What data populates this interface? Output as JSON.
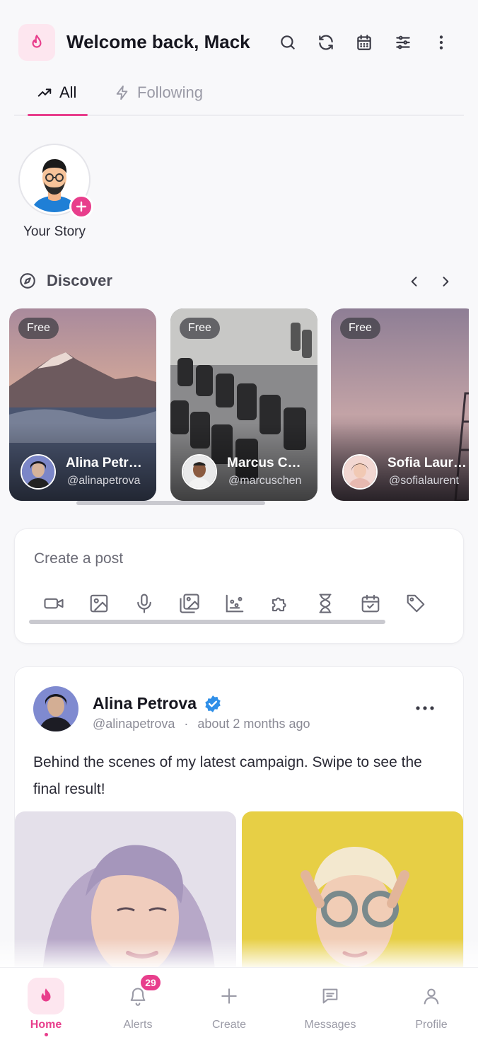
{
  "header": {
    "title": "Welcome back, Mack",
    "icons": [
      "search-icon",
      "refresh-icon",
      "calendar-icon",
      "sliders-icon",
      "more-vertical-icon"
    ]
  },
  "tabs": [
    {
      "label": "All",
      "icon": "trending-icon",
      "active": true
    },
    {
      "label": "Following",
      "icon": "bolt-icon",
      "active": false
    }
  ],
  "story": {
    "label": "Your Story"
  },
  "discover": {
    "title": "Discover",
    "cards": [
      {
        "badge": "Free",
        "name": "Alina Petr…",
        "handle": "@alinapetrova"
      },
      {
        "badge": "Free",
        "name": "Marcus C…",
        "handle": "@marcuschen"
      },
      {
        "badge": "Free",
        "name": "Sofia Laur…",
        "handle": "@sofialaurent"
      }
    ]
  },
  "create_post": {
    "placeholder": "Create a post",
    "tools": [
      "video-icon",
      "image-icon",
      "mic-icon",
      "gallery-icon",
      "chart-icon",
      "puzzle-icon",
      "hourglass-icon",
      "calendar-check-icon",
      "tag-icon"
    ]
  },
  "post": {
    "author": "Alina Petrova",
    "handle": "@alinapetrova",
    "separator": "·",
    "time": "about 2 months ago",
    "text": "Behind the scenes of my latest campaign. Swipe to see the final result!"
  },
  "bottom_nav": [
    {
      "label": "Home",
      "icon": "flame-icon",
      "active": true
    },
    {
      "label": "Alerts",
      "icon": "bell-icon",
      "badge": "29"
    },
    {
      "label": "Create",
      "icon": "plus-icon"
    },
    {
      "label": "Messages",
      "icon": "message-icon"
    },
    {
      "label": "Profile",
      "icon": "user-icon"
    }
  ],
  "colors": {
    "accent": "#e83e8c",
    "accent_soft": "#fde6ef",
    "verified": "#2f8fe8"
  }
}
